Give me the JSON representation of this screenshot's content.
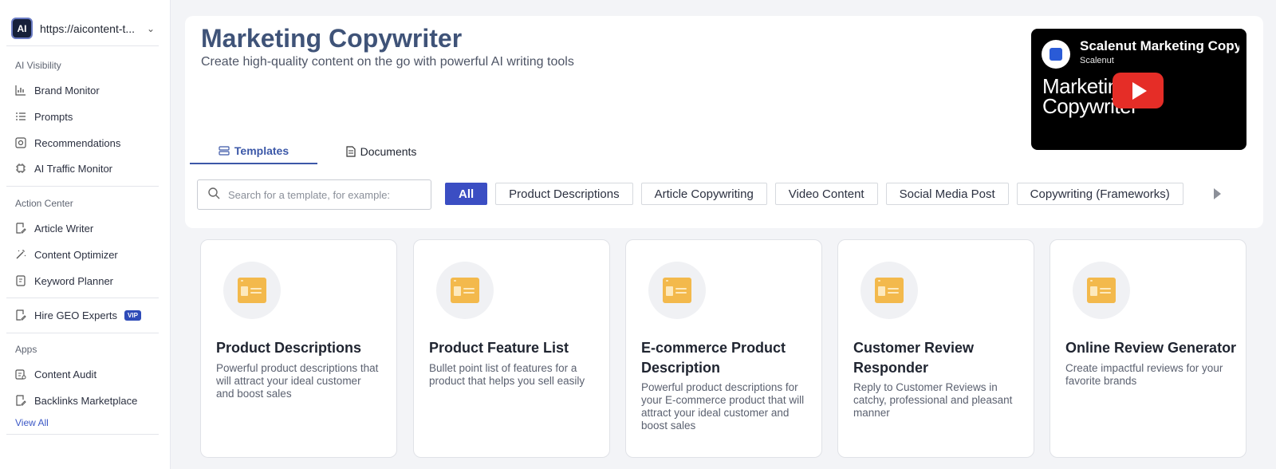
{
  "sidebar": {
    "site_url": "https://aicontent-t...",
    "logo_text": "AI",
    "sections": {
      "ai_visibility": "AI Visibility",
      "action_center": "Action Center",
      "apps": "Apps"
    },
    "items": {
      "brand_monitor": "Brand Monitor",
      "prompts": "Prompts",
      "recommendations": "Recommendations",
      "ai_traffic_monitor": "AI Traffic Monitor",
      "article_writer": "Article Writer",
      "content_optimizer": "Content Optimizer",
      "keyword_planner": "Keyword Planner",
      "hire_geo_experts": "Hire GEO Experts",
      "content_audit": "Content Audit",
      "backlinks_marketplace": "Backlinks Marketplace"
    },
    "vip_badge": "VIP",
    "view_all": "View All"
  },
  "header": {
    "title": "Marketing Copywriter",
    "subtitle": "Create high-quality content on the go with powerful AI writing tools"
  },
  "video": {
    "title": "Scalenut Marketing Copyw",
    "channel": "Scalenut",
    "line1": "Marketin",
    "line2": "Copywriter"
  },
  "tabs": {
    "templates": "Templates",
    "documents": "Documents"
  },
  "search": {
    "placeholder": "Search for a template, for example:"
  },
  "filters": [
    "All",
    "Product Descriptions",
    "Article Copywriting",
    "Video Content",
    "Social Media Post",
    "Copywriting (Frameworks)"
  ],
  "cards": [
    {
      "title": "Product Descriptions",
      "desc": "Powerful product descriptions that will attract your ideal customer and boost sales"
    },
    {
      "title": "Product Feature List",
      "desc": "Bullet point list of features for a product that helps you sell easily"
    },
    {
      "title": "E-commerce Product Description",
      "desc": "Powerful product descriptions for your E-commerce product that will attract your ideal customer and boost sales"
    },
    {
      "title": "Customer Review Responder",
      "desc": "Reply to Customer Reviews in catchy, professional and pleasant manner"
    },
    {
      "title": "Online Review Generator",
      "desc": "Create impactful reviews for your favorite brands"
    }
  ],
  "colors": {
    "accent": "#3b4ec3",
    "title": "#3f5378",
    "card_icon": "#f3b94c"
  }
}
